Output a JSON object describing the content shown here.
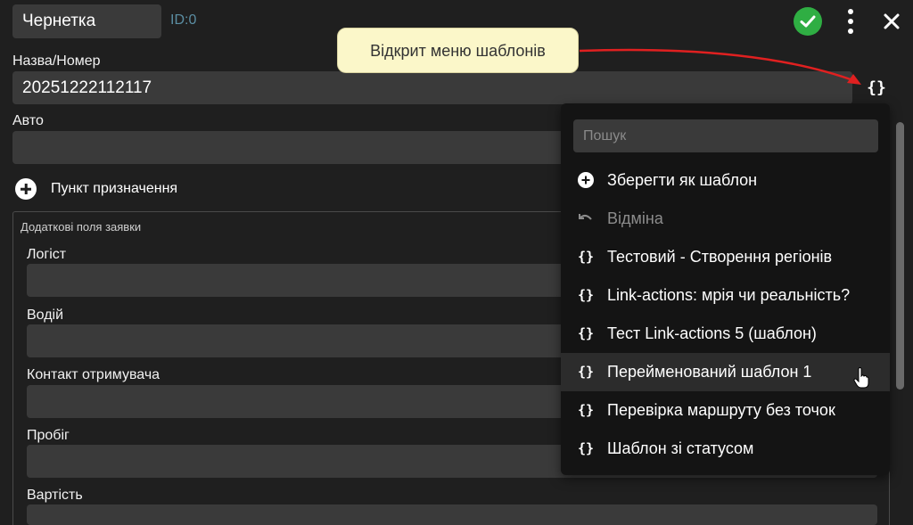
{
  "header": {
    "status": "Чернетка",
    "id_label": "ID:0",
    "confirm_icon": "check-icon",
    "menu_icon": "more-vertical-icon",
    "close_icon": "close-icon"
  },
  "form": {
    "name_label": "Назва/Номер",
    "name_value": "20251222112117",
    "template_icon": "{}",
    "auto_label": "Авто",
    "auto_value": "",
    "add_destination_label": "Пункт призначення",
    "extra_fields_title": "Додаткові поля заявки",
    "extra_fields": [
      {
        "label": "Логіст",
        "value": ""
      },
      {
        "label": "Водій",
        "value": ""
      },
      {
        "label": "Контакт отримувача",
        "value": ""
      },
      {
        "label": "Пробіг",
        "value": ""
      },
      {
        "label": "Вартість",
        "value": ""
      }
    ]
  },
  "template_menu": {
    "search_placeholder": "Пошук",
    "save_label": "Зберегти як шаблон",
    "cancel_label": "Відміна",
    "template_icon": "{}",
    "templates": [
      "Тестовий - Створення регіонів",
      "Link-actions: мрія чи реальність?",
      "Тест Link-actions 5 (шаблон)",
      "Перейменований шаблон 1",
      "Перевірка маршруту без точок",
      "Шаблон зі статусом"
    ],
    "hovered_index": 3
  },
  "annotation": {
    "tooltip_text": "Відкрит меню шаблонів",
    "arrow_color": "#e02020"
  },
  "colors": {
    "background": "#1f1f1f",
    "input": "#3a3a3a",
    "menu": "#141414",
    "confirm": "#2fae43",
    "id_text": "#5b8ea3",
    "tooltip_bg": "#fbf7c9"
  }
}
